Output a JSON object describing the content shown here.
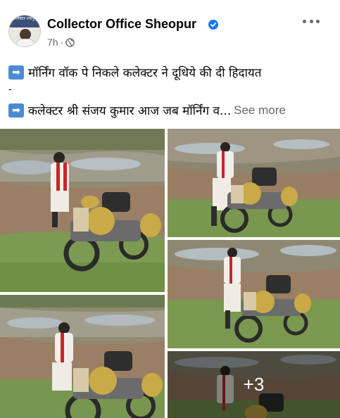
{
  "post": {
    "page_name": "Collector Office Sheopur",
    "time": "7h",
    "separator": "·",
    "avatar_text": "कलेक्टर श्योपुर",
    "line1_icon": "➡",
    "line1": "मॉर्निंग वॉक पे निकले कलेक्टर ने दूधिये की दी हिदायत",
    "dash": "-",
    "line2_icon": "➡",
    "line2": "कलेक्टर श्री संजय कुमार आज जब मॉर्निंग व...",
    "see_more": "See more",
    "more_photos": "+3"
  },
  "icons": {
    "verified": "verified-badge-icon",
    "audience": "globe-icon",
    "options": "more-options-icon",
    "arrow": "right-arrow-icon"
  },
  "colors": {
    "accent": "#1877f2",
    "text": "#050505",
    "secondary": "#65676b",
    "arrow_box": "#4b8bd1"
  }
}
